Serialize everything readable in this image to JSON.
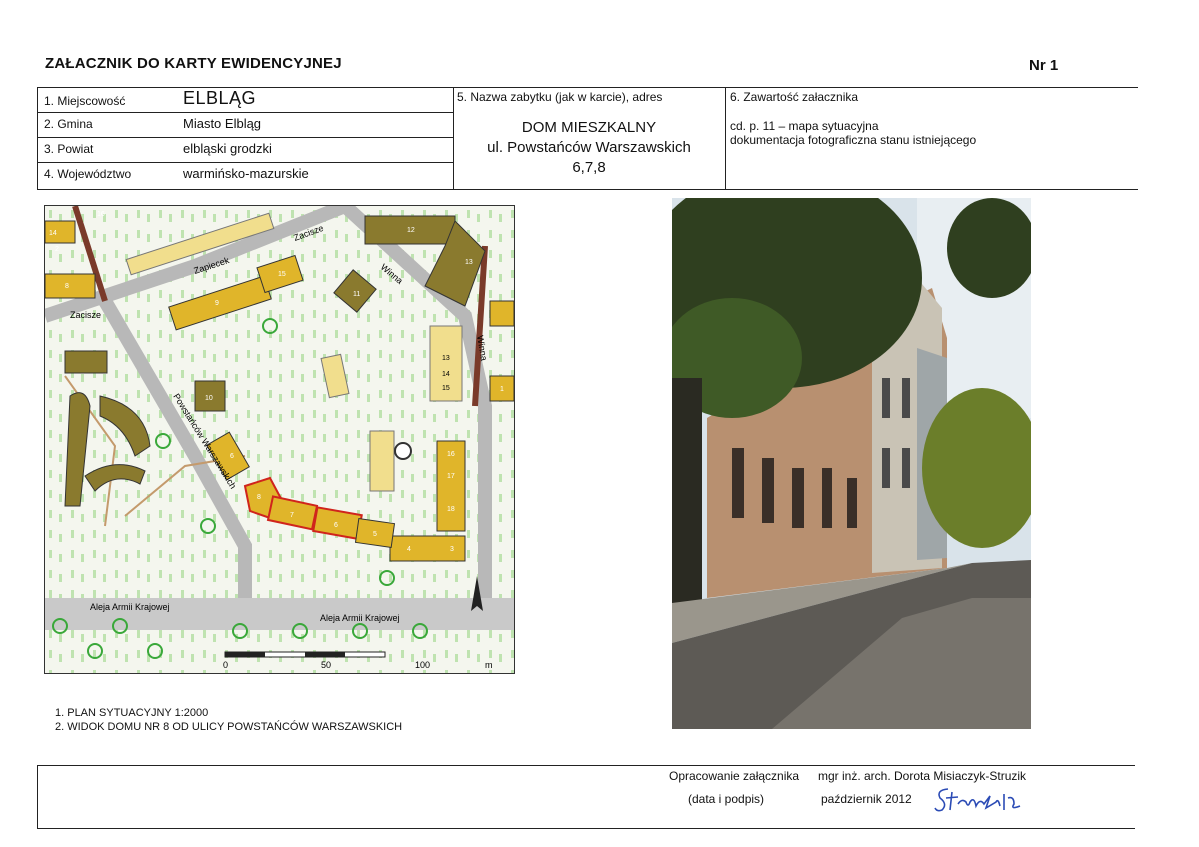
{
  "header": {
    "title": "ZAŁACZNIK DO KARTY EWIDENCYJNEJ",
    "number": "Nr 1"
  },
  "fields": {
    "miejscowosc": {
      "label": "1. Miejscowość",
      "value": "ELBLĄG"
    },
    "gmina": {
      "label": "2. Gmina",
      "value": "Miasto Elbląg"
    },
    "powiat": {
      "label": "3. Powiat",
      "value": "elbląski grodzki"
    },
    "wojewodztwo": {
      "label": "4. Województwo",
      "value": "warmińsko-mazurskie"
    }
  },
  "monument": {
    "label": "5. Nazwa zabytku (jak w karcie), adres",
    "line1": "DOM MIESZKALNY",
    "line2": "ul. Powstańców Warszawskich",
    "line3": "6,7,8"
  },
  "contents": {
    "label": "6. Zawartość załacznika",
    "line1": "cd. p. 11 – mapa sytuacyjna",
    "line2": "dokumentacja fotograficzna stanu istniejącego"
  },
  "map": {
    "streets": [
      "Zacisze",
      "Zacisze",
      "Zapiecek",
      "Winna",
      "Winna",
      "Powstańców Warszawskich",
      "Aleja Armii Krajowej",
      "Aleja Armii Krajowej"
    ],
    "building_numbers": [
      "16",
      "14",
      "12",
      "13",
      "15",
      "9",
      "11",
      "8",
      "10",
      "13",
      "14",
      "15",
      "1",
      "6",
      "16",
      "17",
      "18",
      "8",
      "7",
      "6",
      "5",
      "4",
      "3",
      "2"
    ],
    "scale_labels": [
      "0",
      "50",
      "100",
      "m"
    ]
  },
  "captions": [
    "1. PLAN SYTUACYJNY 1:2000",
    "2. WIDOK DOMU NR 8 OD ULICY POWSTAŃCÓW WARSZAWSKICH"
  ],
  "footer": {
    "prep_label": "Opracowanie załącznika",
    "author": "mgr inż. arch. Dorota Misiaczyk-Struzik",
    "date_label": "(data i podpis)",
    "date": "październik 2012",
    "signature": "Struzik"
  }
}
